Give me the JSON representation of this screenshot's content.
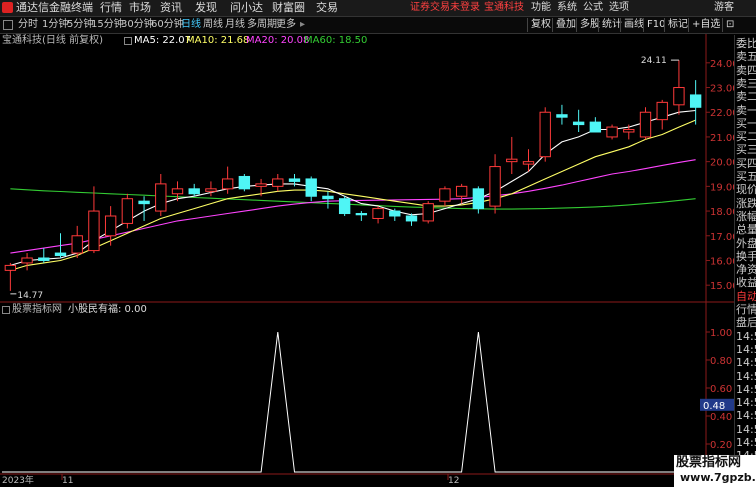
{
  "menubar": {
    "app_name": "通达信金融终端",
    "items": [
      "行情",
      "市场",
      "资讯",
      "发现",
      "问小达",
      "财富圈",
      "交易"
    ],
    "notice": "证券交易未登录",
    "stock": "宝通科技",
    "right": [
      "功能",
      "系统",
      "公式",
      "选项"
    ],
    "guest": "游客"
  },
  "toolbar": {
    "periods": [
      "分时",
      "1分钟",
      "5分钟",
      "15分钟",
      "30分钟",
      "60分钟",
      "日线",
      "周线",
      "月线",
      "多周期",
      "更多"
    ],
    "selected": "日线",
    "right_buttons": [
      "复权",
      "叠加",
      "多股",
      "统计",
      "画线",
      "F10",
      "标记",
      "+自选"
    ]
  },
  "main_legend": {
    "title": "宝通科技(日线 前复权)",
    "ma5": "MA5: 22.07",
    "ma10": "MA10: 21.68",
    "ma20": "MA20: 20.08",
    "ma60": "MA60: 18.50"
  },
  "indicator_legend": {
    "title": "股票指标网",
    "name": "小股民有福: 0.00"
  },
  "price_axis": [
    "24.00",
    "23.00",
    "22.00",
    "21.00",
    "20.00",
    "19.00",
    "18.00",
    "17.00",
    "16.00",
    "15.00"
  ],
  "indicator_axis": [
    "1.00",
    "0.80",
    "0.60",
    "0.40",
    "0.20"
  ],
  "indicator_highlight": "0.48",
  "annotations": {
    "high": "24.11",
    "low": "14.77"
  },
  "right_panel": [
    "委比",
    "卖五",
    "卖四",
    "卖三",
    "卖二",
    "卖一",
    "买一",
    "买二",
    "买三",
    "买四",
    "买五",
    "现价",
    "涨跌",
    "涨幅",
    "总量",
    "外盘",
    "换手",
    "净资",
    "收益",
    "自动",
    "行情",
    "盘后",
    "14:5",
    "14:5",
    "14:5",
    "14:5",
    "14:5",
    "14:5",
    "14:5",
    "14:5",
    "14:5",
    "14:5",
    "14:5"
  ],
  "date_axis": [
    "2023年",
    "11",
    "12"
  ],
  "watermark": {
    "line1": "股票指标网",
    "line2": "www.7gpzb.com"
  },
  "colors": {
    "up": "#ff3a3a",
    "down": "#4ff5f5",
    "ma5": "#ffffff",
    "ma10": "#ffff66",
    "ma20": "#ff44ff",
    "ma60": "#33cc33",
    "indicator": "#ffffff"
  },
  "chart_data": {
    "type": "candlestick",
    "candles": [
      {
        "o": 15.6,
        "h": 15.9,
        "l": 14.77,
        "c": 15.8
      },
      {
        "o": 15.9,
        "h": 16.3,
        "l": 15.6,
        "c": 16.1
      },
      {
        "o": 16.1,
        "h": 16.5,
        "l": 15.9,
        "c": 16.0
      },
      {
        "o": 16.3,
        "h": 17.1,
        "l": 16.1,
        "c": 16.2
      },
      {
        "o": 16.3,
        "h": 17.4,
        "l": 16.1,
        "c": 17.0
      },
      {
        "o": 16.4,
        "h": 19.0,
        "l": 16.3,
        "c": 18.0
      },
      {
        "o": 17.0,
        "h": 18.2,
        "l": 16.6,
        "c": 17.8
      },
      {
        "o": 17.5,
        "h": 18.7,
        "l": 17.3,
        "c": 18.5
      },
      {
        "o": 18.4,
        "h": 18.6,
        "l": 17.6,
        "c": 18.3
      },
      {
        "o": 18.0,
        "h": 19.5,
        "l": 17.8,
        "c": 19.1
      },
      {
        "o": 18.7,
        "h": 19.2,
        "l": 18.4,
        "c": 18.9
      },
      {
        "o": 18.9,
        "h": 19.1,
        "l": 18.6,
        "c": 18.7
      },
      {
        "o": 18.8,
        "h": 19.2,
        "l": 18.6,
        "c": 18.9
      },
      {
        "o": 18.9,
        "h": 19.8,
        "l": 18.7,
        "c": 19.3
      },
      {
        "o": 19.4,
        "h": 19.5,
        "l": 18.8,
        "c": 18.9
      },
      {
        "o": 19.0,
        "h": 19.3,
        "l": 18.6,
        "c": 19.1
      },
      {
        "o": 19.0,
        "h": 19.5,
        "l": 18.8,
        "c": 19.3
      },
      {
        "o": 19.3,
        "h": 19.5,
        "l": 19.0,
        "c": 19.2
      },
      {
        "o": 19.3,
        "h": 19.4,
        "l": 18.4,
        "c": 18.6
      },
      {
        "o": 18.6,
        "h": 18.8,
        "l": 18.1,
        "c": 18.5
      },
      {
        "o": 18.5,
        "h": 18.6,
        "l": 17.8,
        "c": 17.9
      },
      {
        "o": 17.9,
        "h": 18.0,
        "l": 17.6,
        "c": 17.85
      },
      {
        "o": 17.7,
        "h": 18.2,
        "l": 17.5,
        "c": 18.1
      },
      {
        "o": 18.0,
        "h": 18.1,
        "l": 17.6,
        "c": 17.8
      },
      {
        "o": 17.8,
        "h": 17.9,
        "l": 17.4,
        "c": 17.6
      },
      {
        "o": 17.6,
        "h": 18.4,
        "l": 17.5,
        "c": 18.3
      },
      {
        "o": 18.4,
        "h": 19.0,
        "l": 18.2,
        "c": 18.9
      },
      {
        "o": 18.6,
        "h": 19.1,
        "l": 18.3,
        "c": 19.0
      },
      {
        "o": 18.9,
        "h": 19.0,
        "l": 17.9,
        "c": 18.1
      },
      {
        "o": 18.2,
        "h": 20.3,
        "l": 17.9,
        "c": 19.8
      },
      {
        "o": 20.0,
        "h": 21.0,
        "l": 19.5,
        "c": 20.1
      },
      {
        "o": 19.9,
        "h": 20.5,
        "l": 19.6,
        "c": 20.0
      },
      {
        "o": 20.2,
        "h": 22.2,
        "l": 20.0,
        "c": 22.0
      },
      {
        "o": 21.9,
        "h": 22.3,
        "l": 21.5,
        "c": 21.8
      },
      {
        "o": 21.6,
        "h": 22.1,
        "l": 21.2,
        "c": 21.5
      },
      {
        "o": 21.6,
        "h": 21.8,
        "l": 21.2,
        "c": 21.2
      },
      {
        "o": 21.0,
        "h": 21.5,
        "l": 20.9,
        "c": 21.4
      },
      {
        "o": 21.2,
        "h": 21.5,
        "l": 20.9,
        "c": 21.3
      },
      {
        "o": 21.0,
        "h": 22.2,
        "l": 20.9,
        "c": 22.0
      },
      {
        "o": 21.7,
        "h": 22.5,
        "l": 21.3,
        "c": 22.4
      },
      {
        "o": 22.3,
        "h": 24.11,
        "l": 21.9,
        "c": 23.0
      },
      {
        "o": 22.7,
        "h": 23.3,
        "l": 21.5,
        "c": 22.2
      }
    ],
    "ma5": [
      15.8,
      16.0,
      16.05,
      16.1,
      16.3,
      16.8,
      17.2,
      17.6,
      18.0,
      18.3,
      18.5,
      18.6,
      18.75,
      18.9,
      19.0,
      19.05,
      19.1,
      19.1,
      19.0,
      18.9,
      18.6,
      18.3,
      18.2,
      18.0,
      17.85,
      17.9,
      18.1,
      18.3,
      18.5,
      18.8,
      19.2,
      19.6,
      20.3,
      20.8,
      21.0,
      21.3,
      21.3,
      21.4,
      21.6,
      21.8,
      22.0,
      22.07
    ],
    "ma10": [
      15.6,
      15.8,
      15.9,
      16.0,
      16.2,
      16.5,
      16.8,
      17.1,
      17.4,
      17.7,
      17.9,
      18.1,
      18.3,
      18.5,
      18.6,
      18.7,
      18.8,
      18.85,
      18.85,
      18.8,
      18.7,
      18.6,
      18.5,
      18.4,
      18.3,
      18.2,
      18.2,
      18.25,
      18.35,
      18.5,
      18.7,
      19.0,
      19.3,
      19.6,
      19.9,
      20.2,
      20.4,
      20.6,
      20.9,
      21.1,
      21.4,
      21.68
    ],
    "ma20": [
      16.3,
      16.4,
      16.5,
      16.6,
      16.7,
      16.85,
      17.0,
      17.15,
      17.3,
      17.45,
      17.6,
      17.7,
      17.8,
      17.9,
      18.0,
      18.1,
      18.2,
      18.28,
      18.35,
      18.4,
      18.42,
      18.43,
      18.44,
      18.45,
      18.46,
      18.47,
      18.48,
      18.5,
      18.55,
      18.62,
      18.7,
      18.8,
      18.92,
      19.05,
      19.2,
      19.35,
      19.5,
      19.6,
      19.72,
      19.85,
      19.97,
      20.08
    ],
    "ma60": [
      18.9,
      18.86,
      18.82,
      18.79,
      18.76,
      18.73,
      18.7,
      18.67,
      18.64,
      18.61,
      18.58,
      18.55,
      18.52,
      18.49,
      18.46,
      18.43,
      18.4,
      18.37,
      18.34,
      18.31,
      18.28,
      18.25,
      18.22,
      18.19,
      18.16,
      18.14,
      18.12,
      18.1,
      18.09,
      18.08,
      18.08,
      18.09,
      18.1,
      18.12,
      18.14,
      18.17,
      18.2,
      18.25,
      18.3,
      18.36,
      18.43,
      18.5
    ],
    "price_range": [
      14.4,
      24.6
    ],
    "indicator": {
      "name": "小股民有福",
      "values": [
        0,
        0,
        0,
        0,
        0,
        0,
        0,
        0,
        0,
        0,
        0,
        0,
        0,
        0,
        0,
        0,
        1,
        0,
        0,
        0,
        0,
        0,
        0,
        0,
        0,
        0,
        0,
        0,
        1,
        0,
        0,
        0,
        0,
        0,
        0,
        0,
        0,
        0,
        0,
        0,
        0,
        0
      ],
      "range": [
        0,
        1.1
      ]
    }
  }
}
